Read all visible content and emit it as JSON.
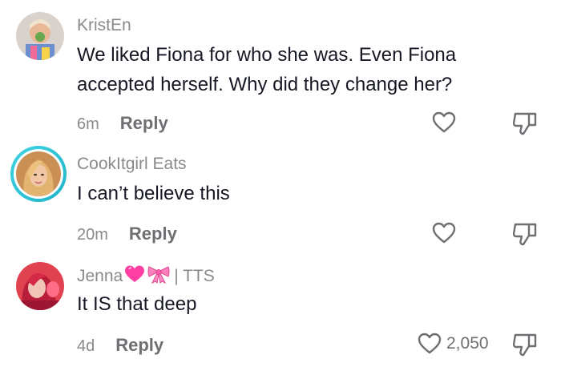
{
  "comments": [
    {
      "username": "KristEn",
      "text": "We liked Fiona for who she was. Even Fiona accepted herself. Why did they change her?",
      "time": "6m",
      "reply_label": "Reply",
      "like_count": ""
    },
    {
      "username": "CookItgirl Eats",
      "text": "I can’t believe this",
      "time": "20m",
      "reply_label": "Reply",
      "like_count": ""
    },
    {
      "username": "Jenna",
      "username_suffix": "| TTS",
      "text": "It IS that deep",
      "time": "4d",
      "reply_label": "Reply",
      "like_count": "2,050"
    }
  ],
  "icons": {
    "like": "heart-outline-icon",
    "dislike": "thumbs-down-outline-icon",
    "username_emojis": [
      "pink-heart-emoji",
      "pink-bow-emoji"
    ]
  },
  "colors": {
    "username": "#8a8a8e",
    "text": "#161823",
    "meta": "#6f6f73",
    "avatar_ring": "#1fb4c7",
    "emoji_pink": "#ff3fa4"
  }
}
